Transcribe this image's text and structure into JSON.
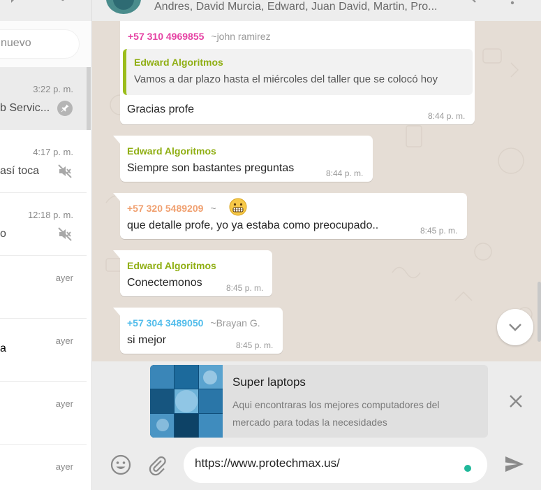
{
  "sidebar": {
    "search_placeholder": "nuevo",
    "chats": [
      {
        "time": "3:22 p. m.",
        "preview": "b Servic...",
        "icon": "pin-icon",
        "active": true
      },
      {
        "time": "4:17 p. m.",
        "preview": "así toca",
        "icon": "muted-icon",
        "active": false
      },
      {
        "time": "12:18 p. m.",
        "preview": "o",
        "icon": "muted-icon",
        "active": false
      },
      {
        "time": "ayer",
        "preview": "",
        "icon": "",
        "active": false
      },
      {
        "time": "ayer",
        "name": "a",
        "icon": "",
        "active": false
      },
      {
        "time": "ayer",
        "preview": "",
        "icon": "",
        "active": false
      },
      {
        "time": "ayer",
        "preview": "",
        "icon": "",
        "active": false
      }
    ]
  },
  "header": {
    "members": "Andres, David Murcia, Edward, Juan David, Martin, Pro..."
  },
  "messages": [
    {
      "sender": "+57 310 4969855",
      "alias": "~john ramirez",
      "sender_color": "#e542a3",
      "quote_name": "Edward Algoritmos",
      "quote_text": "Vamos a dar plazo hasta el miércoles del taller que se colocó hoy",
      "text": "Gracias profe",
      "time": "8:44 p. m."
    },
    {
      "sender": "Edward Algoritmos",
      "sender_color": "#8fae12",
      "text": "Siempre son bastantes preguntas",
      "time": "8:44 p. m."
    },
    {
      "sender": "+57 320 5489209",
      "alias": "~",
      "sender_color": "#f0a070",
      "emoji": "grimacing-face-emoji",
      "text": "que detalle profe, yo ya estaba como preocupado..",
      "time": "8:45 p. m."
    },
    {
      "sender": "Edward Algoritmos",
      "sender_color": "#8fae12",
      "text": "Conectemonos",
      "time": "8:45 p. m."
    },
    {
      "sender": "+57 304 3489050",
      "alias": "~Brayan G.",
      "sender_color": "#53bdeb",
      "text": "si mejor",
      "time": "8:45 p. m."
    }
  ],
  "link_preview": {
    "title": "Super laptops",
    "description": "Aqui encontraras los mejores computadores del mercado para todas la necesidades"
  },
  "composer": {
    "text": "https://www.protechmax.us/"
  },
  "colors": {
    "accent": "#1fb89a",
    "chat_bg": "#e5ddd5",
    "quote_bar": "#9bbd1c"
  }
}
